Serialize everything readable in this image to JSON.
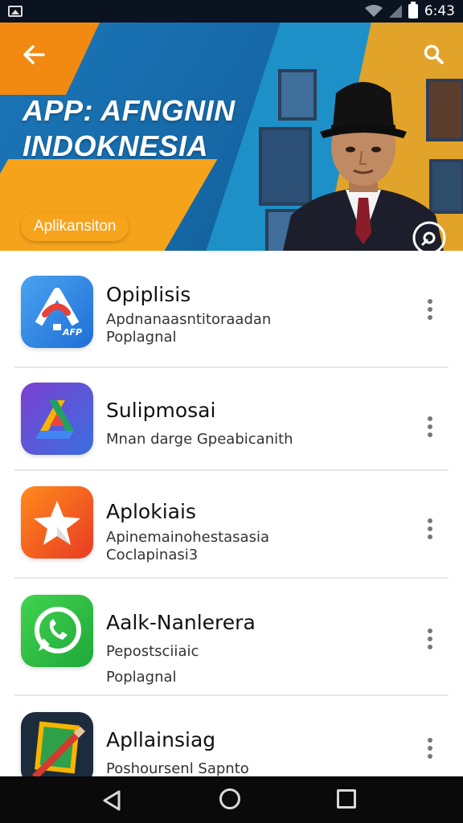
{
  "status_bar": {
    "time": "6:43"
  },
  "hero": {
    "title_line1": "APP: AFNGNIN",
    "title_line2": "INDOKNESIA",
    "chip_label": "Aplikansiton"
  },
  "apps": [
    {
      "title": "Opiplisis",
      "subtitle1": "Apdnanaasntitoraadan",
      "subtitle2": "Poplagnal",
      "icon": "app-logo-icon",
      "icon_text": "AFP"
    },
    {
      "title": "Sulipmosai",
      "subtitle1": "Mnan darge Gpeabicanith",
      "subtitle2": "",
      "icon": "drive-triangle-icon"
    },
    {
      "title": "Aplokiais",
      "subtitle1": "Apinemainohestasasia",
      "subtitle2": "Coclapinasi3",
      "icon": "star-icon"
    },
    {
      "title": "Aalk-Nanlerera",
      "subtitle1": "Pepostsciiaic",
      "subtitle2": "Poplagnal",
      "icon": "whatsapp-icon"
    },
    {
      "title": "Apllainsiag",
      "subtitle1": "Poshoursenl Sapnto",
      "subtitle2": "",
      "icon": "pencil-icon"
    }
  ]
}
